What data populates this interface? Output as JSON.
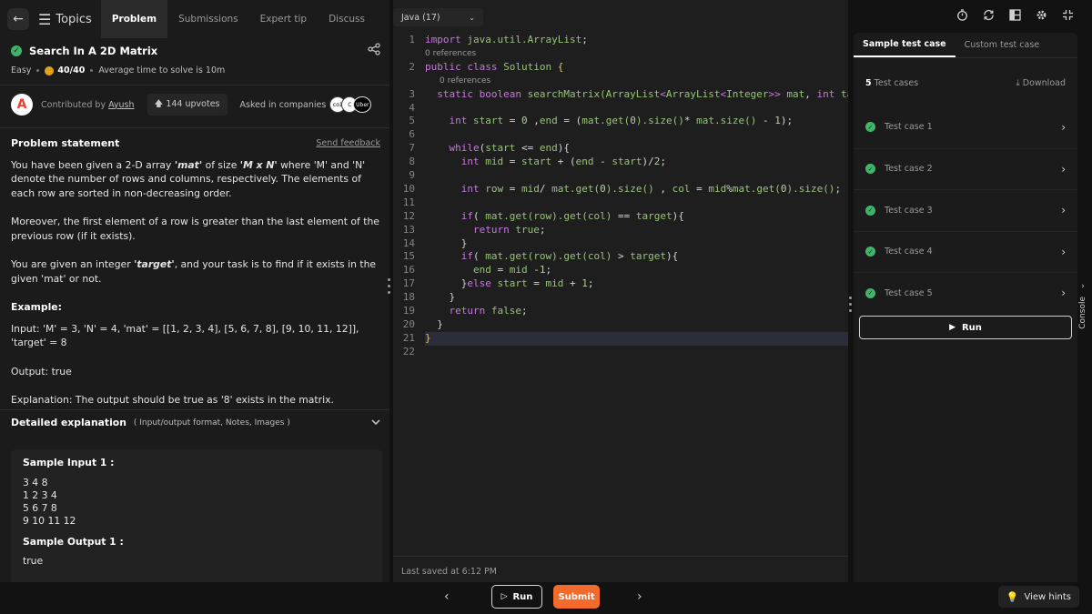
{
  "nav": {
    "topics_label": "Topics",
    "tabs": [
      {
        "label": "Problem",
        "active": true
      },
      {
        "label": "Submissions",
        "active": false
      },
      {
        "label": "Expert tip",
        "active": false
      },
      {
        "label": "Discuss",
        "active": false
      }
    ]
  },
  "problem": {
    "title": "Search In A 2D Matrix",
    "difficulty": "Easy",
    "score": "40/40",
    "avg_time": "Average time to solve is 10m",
    "contributed_label": "Contributed by",
    "contributor": "Ayush",
    "avatar_letter": "A",
    "upvotes": "144 upvotes",
    "asked_label": "Asked in companies",
    "companies": [
      "co1",
      "C",
      "Uber"
    ],
    "statement_heading": "Problem statement",
    "feedback_link": "Send feedback",
    "para1_pre": "You have been given a 2-D array ",
    "para1_mat": "'mat'",
    "para1_mid": " of size ",
    "para1_size": "'M x N'",
    "para1_post": " where 'M' and 'N' denote the number of rows and columns, respectively. The elements of each row are sorted in non-decreasing order.",
    "para2": "Moreover, the first element of a row is greater than the last element of the previous row (if it exists).",
    "para3_pre": "You are given an integer ",
    "para3_target": "'target'",
    "para3_post": ", and your task is to find if it exists in the given 'mat' or not.",
    "example_heading": "Example:",
    "example_input": "Input: 'M' = 3, 'N' = 4, 'mat' = [[1, 2, 3, 4], [5, 6, 7, 8], [9, 10, 11, 12]], 'target' = 8",
    "example_output": "Output: true",
    "example_explanation": "Explanation: The output should be true as '8' exists in the matrix.",
    "detailed_heading": "Detailed explanation",
    "detailed_sub": "( Input/output format, Notes, Images )",
    "sample_input_heading": "Sample Input 1 :",
    "sample_input_lines": [
      "3 4 8",
      "1 2 3 4",
      "5 6 7 8",
      "9 10 11 12"
    ],
    "sample_output_heading": "Sample Output 1 :",
    "sample_output": "true"
  },
  "editor": {
    "language": "Java (17)",
    "references_label": "0 references",
    "last_saved": "Last saved at 6:12 PM",
    "line_numbers": [
      "1",
      "2",
      "3",
      "4",
      "5",
      "6",
      "7",
      "8",
      "9",
      "10",
      "11",
      "12",
      "13",
      "14",
      "15",
      "16",
      "17",
      "18",
      "19",
      "20",
      "21",
      "22"
    ]
  },
  "tests": {
    "tabs": [
      {
        "label": "Sample test case",
        "active": true
      },
      {
        "label": "Custom test case",
        "active": false
      }
    ],
    "count": "5",
    "count_label": "Test cases",
    "download": "Download",
    "cases": [
      "Test case 1",
      "Test case 2",
      "Test case 3",
      "Test case 4",
      "Test case 5"
    ],
    "run_label": "Run",
    "console_label": "Console"
  },
  "bottom": {
    "run_label": "Run",
    "submit_label": "Submit",
    "hints_label": "View hints"
  },
  "colors": {
    "accent": "#f26b2c",
    "success": "#3fb46a"
  }
}
